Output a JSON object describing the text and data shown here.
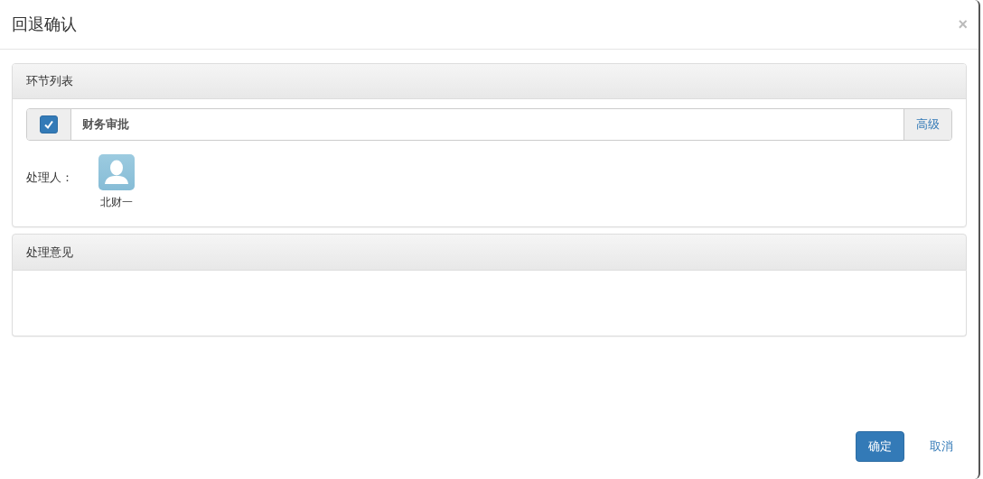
{
  "window": {
    "title": "回退确认",
    "close": "×"
  },
  "step_panel": {
    "title": "环节列表",
    "steps": [
      {
        "name": "财务审批",
        "checked": true,
        "action": "高级"
      }
    ],
    "handler_label": "处理人：",
    "handlers": [
      {
        "name": "北财一"
      }
    ]
  },
  "opinion_panel": {
    "title": "处理意见"
  },
  "buttons": [
    {
      "label": "确定",
      "kind": "primary"
    },
    {
      "label": "取消",
      "kind": "link"
    }
  ]
}
